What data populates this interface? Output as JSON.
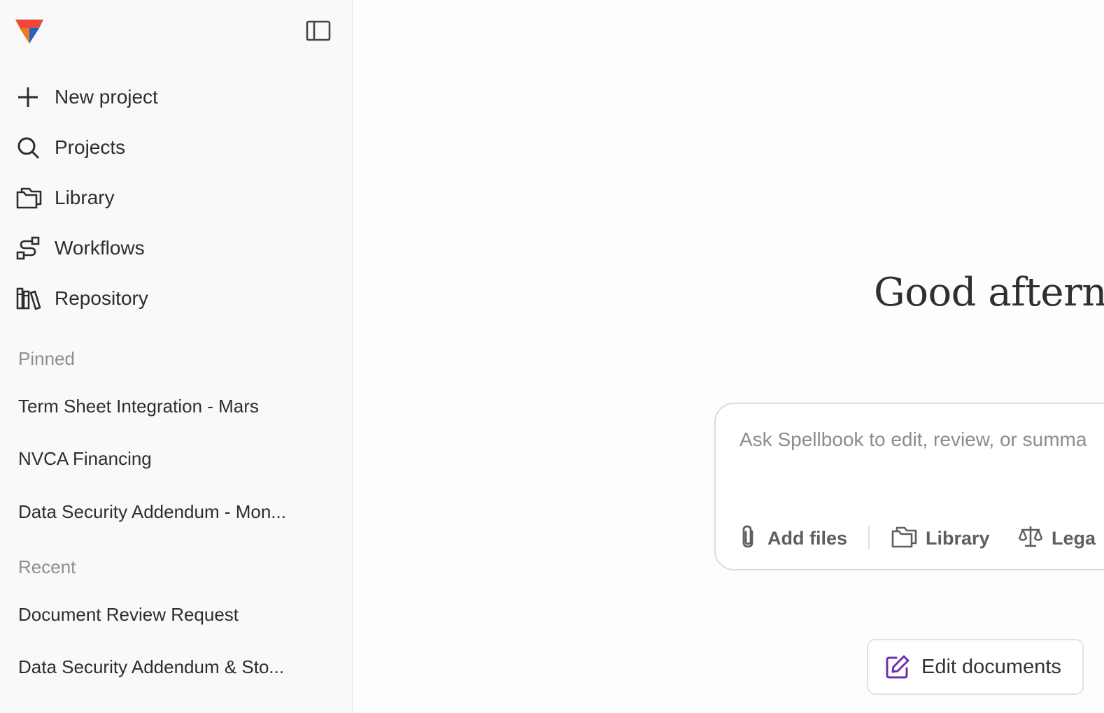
{
  "sidebar": {
    "nav": [
      {
        "label": "New project",
        "icon": "plus-icon"
      },
      {
        "label": "Projects",
        "icon": "search-icon"
      },
      {
        "label": "Library",
        "icon": "folders-icon"
      },
      {
        "label": "Workflows",
        "icon": "workflow-icon"
      },
      {
        "label": "Repository",
        "icon": "books-icon"
      }
    ],
    "pinned_label": "Pinned",
    "pinned": [
      "Term Sheet Integration - Mars",
      "NVCA Financing",
      "Data Security Addendum - Mon..."
    ],
    "recent_label": "Recent",
    "recent": [
      "Document Review Request",
      "Data Security Addendum & Sto..."
    ]
  },
  "main": {
    "greeting": "Good afternc",
    "composer": {
      "placeholder": "Ask Spellbook to edit, review, or summa",
      "tools": [
        {
          "label": "Add files",
          "icon": "paperclip-icon"
        },
        {
          "label": "Library",
          "icon": "folders-icon"
        },
        {
          "label": "Lega",
          "icon": "scale-icon"
        }
      ]
    },
    "chips": [
      {
        "label": "Edit documents",
        "icon": "edit-icon",
        "color": "#6b2fb0"
      }
    ]
  },
  "colors": {
    "sidebar_bg": "#f9f9f9",
    "main_bg": "#fdfdfd",
    "accent": "#6b2fb0",
    "muted_text": "#8e8e8e"
  }
}
